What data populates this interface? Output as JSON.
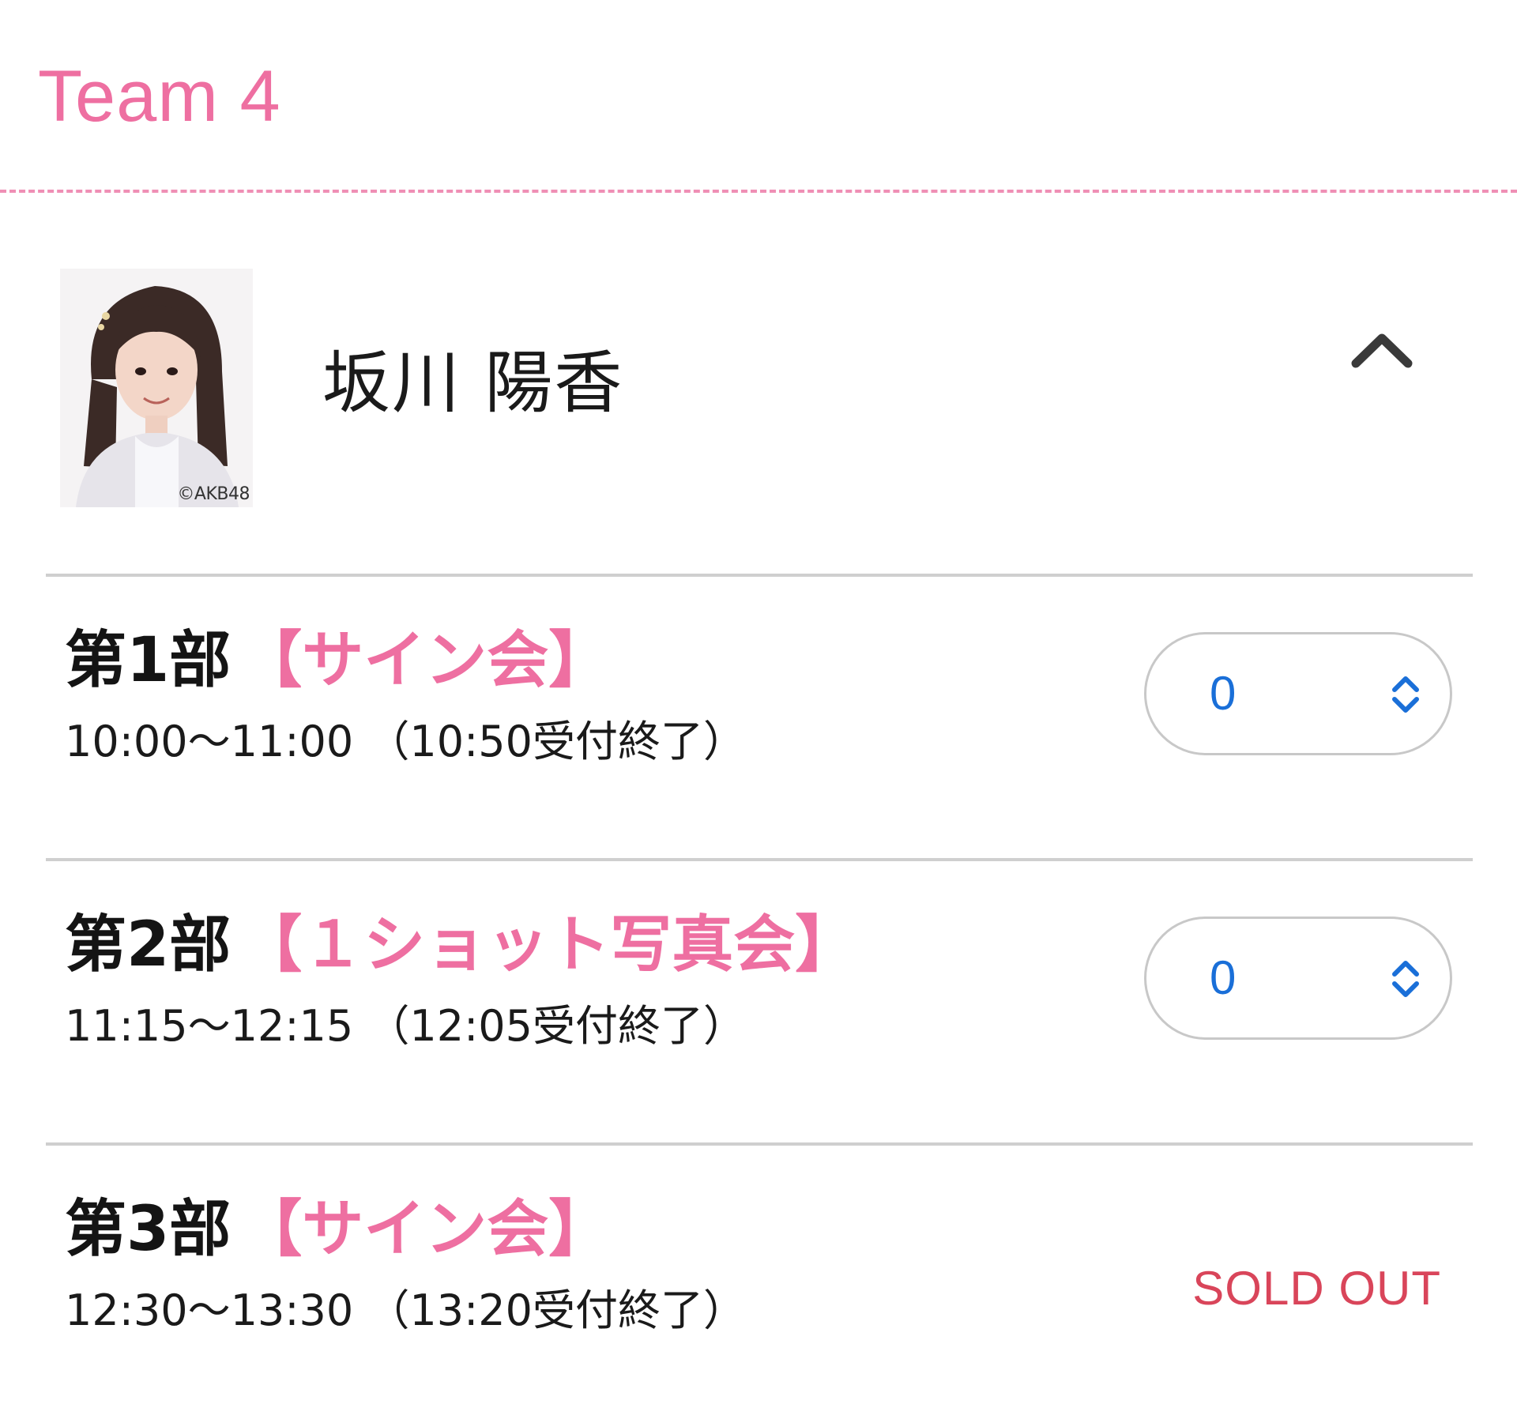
{
  "team": {
    "title": "Team 4"
  },
  "member": {
    "name": "坂川 陽香",
    "photo_credit": "©AKB48",
    "collapse_icon": "chevron-up-icon"
  },
  "sessions": [
    {
      "part": "第1部",
      "type": "【サイン会】",
      "time": "10:00〜11:00 （10:50受付終了）",
      "quantity": "0",
      "sold_out": ""
    },
    {
      "part": "第2部",
      "type": "【１ショット写真会】",
      "time": "11:15〜12:15 （12:05受付終了）",
      "quantity": "0",
      "sold_out": ""
    },
    {
      "part": "第3部",
      "type": "【サイン会】",
      "time": "12:30〜13:30 （13:20受付終了）",
      "quantity": "",
      "sold_out": "SOLD OUT"
    }
  ],
  "colors": {
    "accent_pink": "#ee6fa1",
    "select_value_blue": "#1a6fd8",
    "sold_out_red": "#d9455a",
    "divider_gray": "#cfcfcf"
  }
}
